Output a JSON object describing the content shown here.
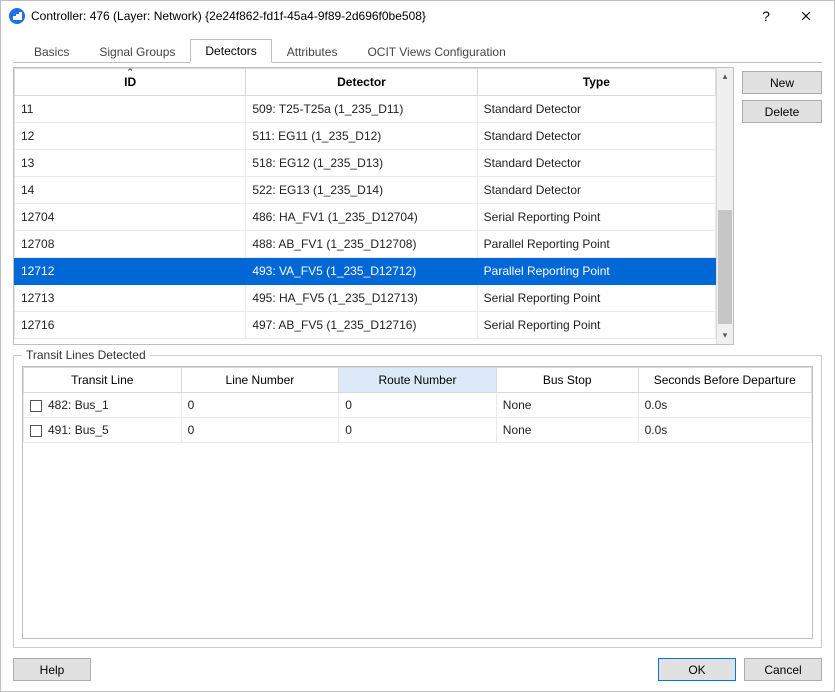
{
  "title": "Controller: 476 (Layer: Network) {2e24f862-fd1f-45a4-9f89-2d696f0be508}",
  "tabs": {
    "items": [
      "Basics",
      "Signal Groups",
      "Detectors",
      "Attributes",
      "OCIT Views Configuration"
    ],
    "active_index": 2
  },
  "side_buttons": {
    "new": "New",
    "delete": "Delete"
  },
  "detectors": {
    "columns": [
      "ID",
      "Detector",
      "Type"
    ],
    "sort_col": 0,
    "rows": [
      {
        "id": "11",
        "detector": "509: T25-T25a (1_235_D11)",
        "type": "Standard Detector",
        "selected": false
      },
      {
        "id": "12",
        "detector": "511: EG11 (1_235_D12)",
        "type": "Standard Detector",
        "selected": false
      },
      {
        "id": "13",
        "detector": "518: EG12 (1_235_D13)",
        "type": "Standard Detector",
        "selected": false
      },
      {
        "id": "14",
        "detector": "522: EG13 (1_235_D14)",
        "type": "Standard Detector",
        "selected": false
      },
      {
        "id": "12704",
        "detector": "486: HA_FV1 (1_235_D12704)",
        "type": "Serial Reporting Point",
        "selected": false
      },
      {
        "id": "12708",
        "detector": "488: AB_FV1 (1_235_D12708)",
        "type": "Parallel Reporting Point",
        "selected": false
      },
      {
        "id": "12712",
        "detector": "493: VA_FV5 (1_235_D12712)",
        "type": "Parallel Reporting Point",
        "selected": true
      },
      {
        "id": "12713",
        "detector": "495: HA_FV5 (1_235_D12713)",
        "type": "Serial Reporting Point",
        "selected": false
      },
      {
        "id": "12716",
        "detector": "497: AB_FV5 (1_235_D12716)",
        "type": "Serial Reporting Point",
        "selected": false
      }
    ]
  },
  "transit": {
    "group_label": "Transit Lines Detected",
    "columns": [
      "Transit Line",
      "Line Number",
      "Route Number",
      "Bus Stop",
      "Seconds Before Departure"
    ],
    "sorted_col": 2,
    "rows": [
      {
        "checked": false,
        "line": "482: Bus_1",
        "line_number": "0",
        "route_number": "0",
        "bus_stop": "None",
        "seconds": "0.0s"
      },
      {
        "checked": false,
        "line": "491: Bus_5",
        "line_number": "0",
        "route_number": "0",
        "bus_stop": "None",
        "seconds": "0.0s"
      }
    ]
  },
  "footer": {
    "help": "Help",
    "ok": "OK",
    "cancel": "Cancel"
  }
}
